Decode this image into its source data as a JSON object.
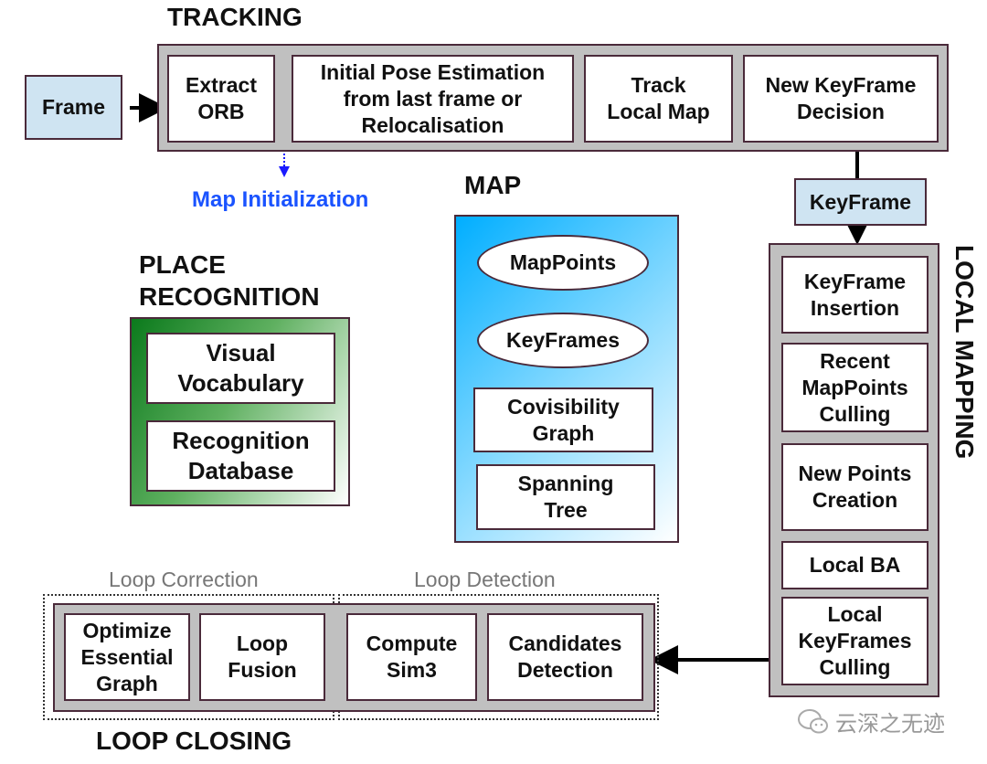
{
  "colors": {
    "frame_fill": "#cfe4f2",
    "module_fill": "#c0c0c0",
    "map_gradient_start": "#00aeff",
    "place_gradient_start": "#0b7a1c",
    "map_init_text": "#1a53ff",
    "border": "#4a2a3a"
  },
  "tracking": {
    "title": "TRACKING",
    "steps": [
      "Extract\nORB",
      "Initial Pose Estimation\nfrom last frame or\nRelocalisation",
      "Track\nLocal Map",
      "New KeyFrame\nDecision"
    ]
  },
  "frame": {
    "label": "Frame"
  },
  "map_initialization": {
    "label": "Map Initialization"
  },
  "map": {
    "title": "MAP",
    "items": [
      "MapPoints",
      "KeyFrames",
      "Covisibility\nGraph",
      "Spanning\nTree"
    ]
  },
  "place_recognition": {
    "title": "PLACE\nRECOGNITION",
    "items": [
      "Visual\nVocabulary",
      "Recognition\nDatabase"
    ]
  },
  "keyframe": {
    "label": "KeyFrame"
  },
  "local_mapping": {
    "title": "LOCAL MAPPING",
    "steps": [
      "KeyFrame\nInsertion",
      "Recent\nMapPoints\nCulling",
      "New Points\nCreation",
      "Local BA",
      "Local\nKeyFrames\nCulling"
    ]
  },
  "loop_closing": {
    "title": "LOOP CLOSING",
    "loop_correction": {
      "label": "Loop Correction",
      "steps": [
        "Optimize\nEssential\nGraph",
        "Loop\nFusion"
      ]
    },
    "loop_detection": {
      "label": "Loop Detection",
      "steps": [
        "Compute\nSim3",
        "Candidates\nDetection"
      ]
    }
  },
  "watermark": {
    "text": "云深之无迹",
    "icon": "wechat-icon"
  }
}
